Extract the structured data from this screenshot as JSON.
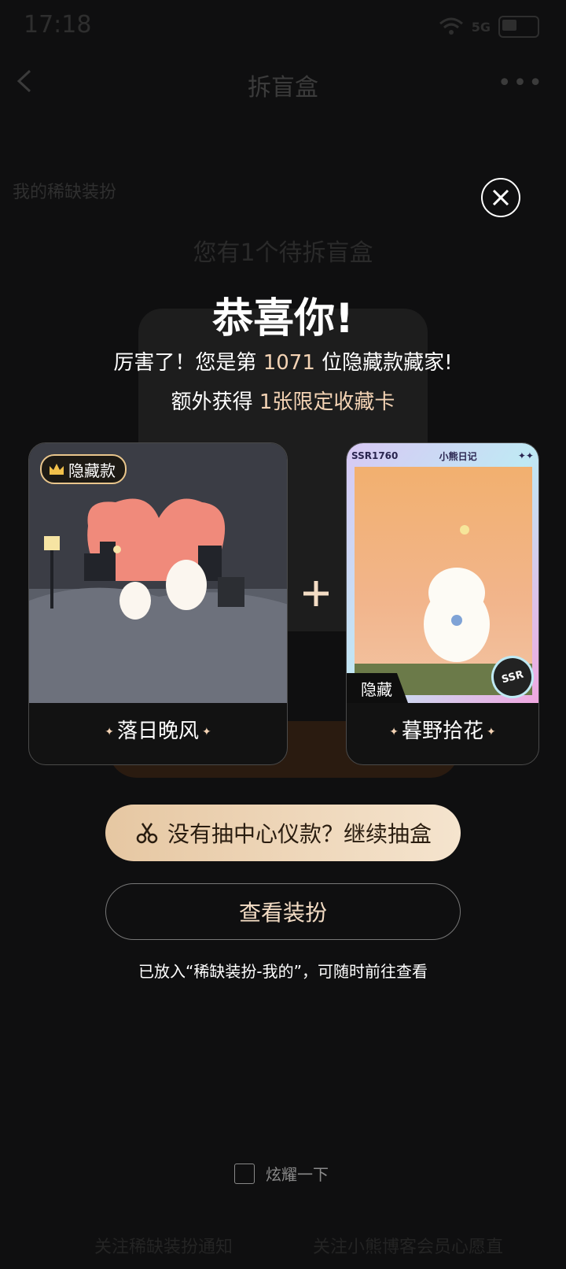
{
  "status_bar": {
    "time": "17:18",
    "signal": "5G"
  },
  "nav": {
    "title": "拆盲盒"
  },
  "background": {
    "my_rare": "我的稀缺装扮",
    "pending": "您有1个待拆盲盒",
    "footer_left": "关注稀缺装扮通知",
    "footer_right": "关注小熊博客会员心愿直"
  },
  "modal": {
    "congrats": "恭喜你!",
    "line1_prefix": "厉害了！您是第",
    "line1_number": "1071",
    "line1_suffix": "位隐藏款藏家!",
    "line2_prefix": "额外获得",
    "line2_highlight": "1张限定收藏卡",
    "left_card": {
      "badge": "隐藏款",
      "name": "落日晚风"
    },
    "right_card": {
      "tag": "隐藏",
      "name": "暮野拾花",
      "ssr_code": "SSR1760",
      "series": "小熊日记",
      "ssr_badge": "SSR"
    },
    "draw_button": "没有抽中心仪款？继续抽盒",
    "view_button": "查看装扮",
    "note": "已放入“稀缺装扮-我的”，可随时前往查看",
    "show_off": "炫耀一下"
  },
  "colors": {
    "accent": "#f4d3b4",
    "button_gradient_start": "#e6c7a2",
    "button_gradient_end": "#f5e4ce"
  }
}
